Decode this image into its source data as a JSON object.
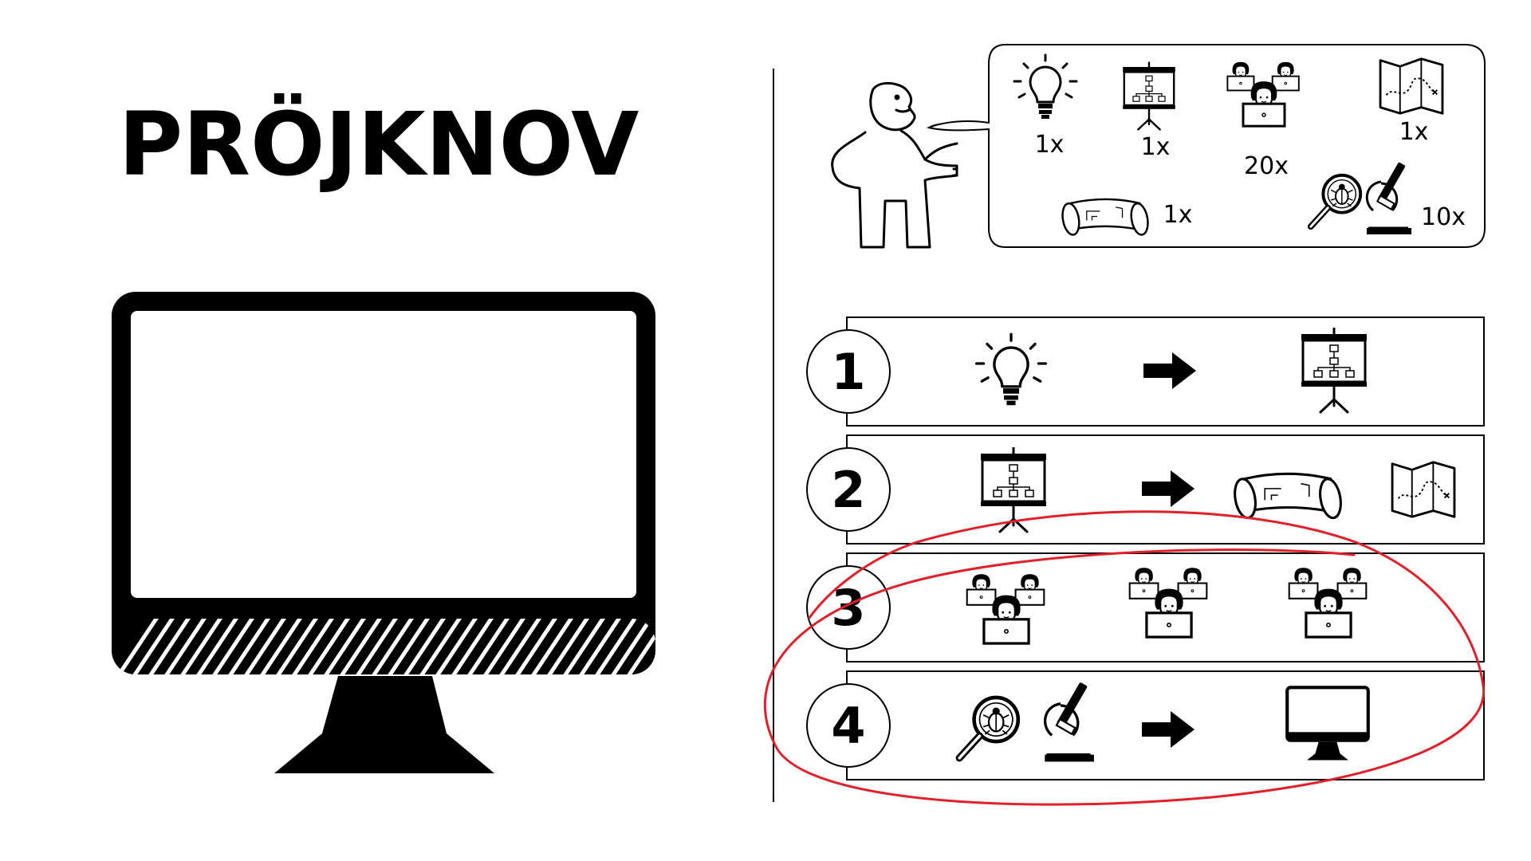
{
  "title": "PRÖJKNOV",
  "parts": [
    {
      "icon": "lightbulb-icon",
      "qty": "1x"
    },
    {
      "icon": "presentation-board-icon",
      "qty": "1x"
    },
    {
      "icon": "developers-icon",
      "qty": "20x"
    },
    {
      "icon": "map-icon",
      "qty": "1x"
    },
    {
      "icon": "blueprint-scroll-icon",
      "qty": "1x"
    },
    {
      "icon": "bug-search-microscope-icon",
      "qty": "10x"
    }
  ],
  "steps": [
    {
      "number": "1",
      "content": [
        "lightbulb-icon",
        "arrow-right-icon",
        "presentation-board-icon"
      ]
    },
    {
      "number": "2",
      "content": [
        "presentation-board-icon",
        "arrow-right-icon",
        "blueprint-scroll-icon",
        "map-icon"
      ]
    },
    {
      "number": "3",
      "content": [
        "developers-icon",
        "developers-icon",
        "developers-icon"
      ]
    },
    {
      "number": "4",
      "content": [
        "bug-search-icon",
        "microscope-icon",
        "arrow-right-icon",
        "monitor-icon"
      ]
    }
  ],
  "colors": {
    "ink": "#000000",
    "annotation": "#e0202a",
    "background": "#ffffff"
  }
}
